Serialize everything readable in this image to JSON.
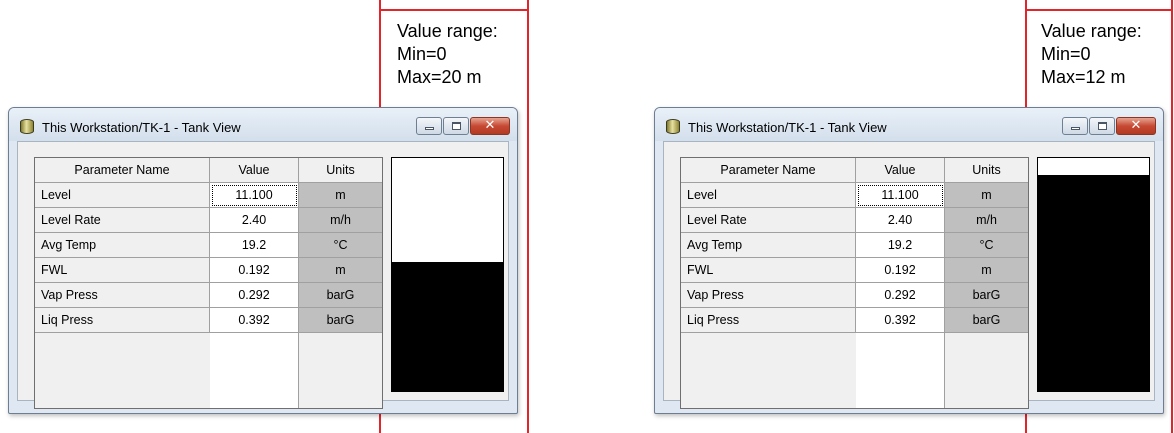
{
  "callouts": [
    {
      "line1": "Value range:",
      "line2": "Min=0",
      "line3": "Max=20 m"
    },
    {
      "line1": "Value range:",
      "line2": "Min=0",
      "line3": "Max=12 m"
    }
  ],
  "colors": {
    "callout_line": "#e3242b",
    "tank_fill": "#000000",
    "tank_empty": "#ffffff",
    "units_bg": "#bfbfbf"
  },
  "windows": [
    {
      "title": "This Workstation/TK-1 - Tank View",
      "icon": "tank-icon",
      "close_symbol": "✕",
      "columns": [
        "Parameter Name",
        "Value",
        "Units"
      ],
      "rows": [
        {
          "name": "Level",
          "value": "11.100",
          "unit": "m"
        },
        {
          "name": "Level Rate",
          "value": "2.40",
          "unit": "m/h"
        },
        {
          "name": "Avg Temp",
          "value": "19.2",
          "unit": "°C"
        },
        {
          "name": "FWL",
          "value": "0.192",
          "unit": "m"
        },
        {
          "name": "Vap Press",
          "value": "0.292",
          "unit": "barG"
        },
        {
          "name": "Liq Press",
          "value": "0.392",
          "unit": "barG"
        }
      ],
      "tank_fill_fraction": 0.555
    },
    {
      "title": "This Workstation/TK-1 - Tank View",
      "icon": "tank-icon",
      "close_symbol": "✕",
      "columns": [
        "Parameter Name",
        "Value",
        "Units"
      ],
      "rows": [
        {
          "name": "Level",
          "value": "11.100",
          "unit": "m"
        },
        {
          "name": "Level Rate",
          "value": "2.40",
          "unit": "m/h"
        },
        {
          "name": "Avg Temp",
          "value": "19.2",
          "unit": "°C"
        },
        {
          "name": "FWL",
          "value": "0.192",
          "unit": "m"
        },
        {
          "name": "Vap Press",
          "value": "0.292",
          "unit": "barG"
        },
        {
          "name": "Liq Press",
          "value": "0.392",
          "unit": "barG"
        }
      ],
      "tank_fill_fraction": 0.925
    }
  ]
}
